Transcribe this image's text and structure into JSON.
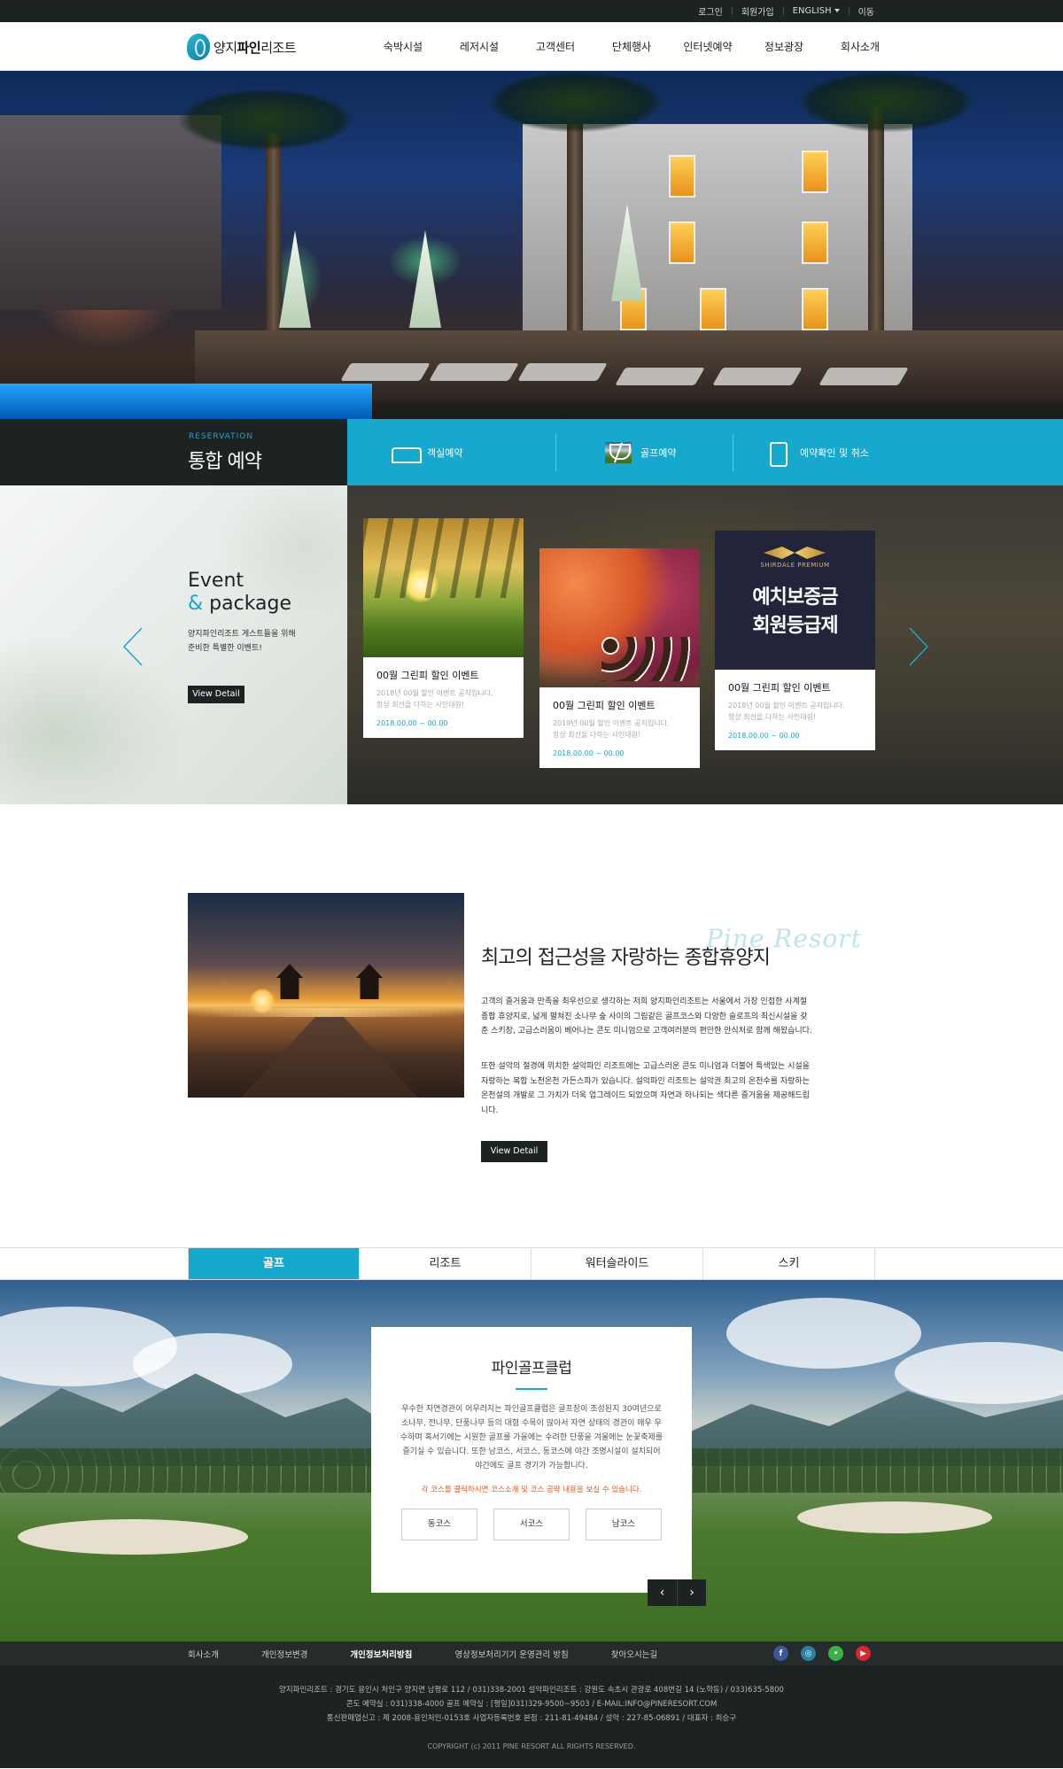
{
  "topbar": {
    "links": [
      "로그인",
      "회원가입",
      "ENGLISH",
      "이동"
    ]
  },
  "header": {
    "logo_pre": "양지",
    "logo_bold": "파인",
    "logo_post": "리조트",
    "nav": [
      "숙박시설",
      "레저시설",
      "고객센터",
      "단체행사",
      "인터넷예약",
      "정보광장",
      "회사소개"
    ]
  },
  "reservation": {
    "eyebrow": "RESERVATION",
    "title": "통합 예약",
    "items": [
      {
        "label": "객실예약",
        "icon": "bed-icon"
      },
      {
        "label": "골프예약",
        "icon": "golf-icon"
      },
      {
        "label": "예약확인 및 취소",
        "icon": "phone-icon"
      }
    ]
  },
  "event": {
    "title_line1": "Event",
    "amp": "&",
    "title_line2": "package",
    "desc_line1": "양지파인리조트 게스트들을 위해",
    "desc_line2": "준비한 특별한 이벤트!",
    "button": "View Detail",
    "cards": [
      {
        "title": "00월 그린피 할인 이벤트",
        "desc1": "2018년 00월 할인 이벤트 공지입니다.",
        "desc2": "항상 최선을 다하는 사인대원!",
        "date": "2018.00.00 ~ 00.00"
      },
      {
        "title": "00월 그린피 할인 이벤트",
        "desc1": "2019년 00월 할인 이벤트 공지입니다.",
        "desc2": "항상 최선을 다하는 사인대원!",
        "date": "2018.00.00 ~ 00.00"
      },
      {
        "title": "00월 그린피 할인 이벤트",
        "desc1": "2018년 00월 할인 이벤트 공지입니다.",
        "desc2": "항상 최선을 다하는 사인대원!",
        "date": "2018.00.00 ~ 00.00"
      }
    ],
    "promo": {
      "brand": "SHIRDALE PREMIUM",
      "line1": "예치보증금",
      "line2": "회원등급제"
    }
  },
  "about": {
    "script": "Pine Resort",
    "heading": "최고의 접근성을 자랑하는 종합휴양지",
    "para1": "고객의 즐거움과 만족을 최우선으로 생각하는 저희 양지파인리조트는 서울에서 가장 인접한 사계절 종합 휴양지로, 넓게 펼쳐진 소나무 숲 사이의 그림같은 골프코스와 다양한 슬로프의 최신시설을 갖춘 스키장, 고급스러움이 베어나는 콘도 미니엄으로 고객여러분의 편안한 안식처로 함께 해왔습니다.",
    "para2": "또한 설악의 절경에 위치한 설악파인 리조트에는 고급스러운 콘도 미니엄과 더불어 특색있는 시설을 자랑하는 복합 노천온천 가든스파가 있습니다. 설악파인 리조트는 설악권 최고의 온천수를 자랑하는 온천설의 개발로 그 가치가 더욱 업그레이드 되었으며 자연과 하나되는 색다른 즐거움을 제공해드립니다.",
    "button": "View Detail"
  },
  "tabs": [
    "골프",
    "리조트",
    "워터슬라이드",
    "스키"
  ],
  "golf": {
    "title": "파인골프클럽",
    "desc": "우수한 자연경관이 어우러지는 파인골프클럽은 골프장이 조성된지 30여년으로 소나무, 전나무, 단풍나무 등의 대형 수목이 많아서 자연 상태의 경관이 매우 우수하며 혹서기에는 시원한 골프를 가을에는 수려한 단풍을 겨울에는 눈꽃축제를 즐기실 수 있습니다. 또한 남코스, 서코스, 동코스에 야간 조명시설이 설치되어 야간에도 골프 경기가 가능합니다.",
    "note": "각 코스를 클릭하시면 코스소개 및 코스 공략 내용을 보실 수 있습니다.",
    "courses": [
      "동코스",
      "서코스",
      "남코스"
    ]
  },
  "footer": {
    "links": [
      "회사소개",
      "개인정보변경",
      "개인정보처리방침",
      "영상정보처리기기 운영관리 방침",
      "찾아오시는길"
    ],
    "line1": "양지파인리조트 : 경기도 용인시 처인구 양지면 남평로 112 / 031)338-2001     설악파인리조트 : 강원도 속초시 관광로 408번길 14 (노학동) / 033)635-5800",
    "line2": "콘도 예약실 : 031)338-4000    골프 예약실 : [평일]031)329-9500~9503 / E-MAIL:INFO@PINERESORT.COM",
    "line3": "통신판매업신고 : 제 2008-용인처인-0153호    사업자등록번호 본점 : 211-81-49484 / 설악 : 227-85-06891 / 대표자 : 최승구",
    "copyright": "COPYRIGHT (c) 2011 PINE RESORT ALL RIGHTS RESERVED.",
    "sns": [
      {
        "name": "facebook-icon",
        "glyph": "f",
        "color": "#3b5998"
      },
      {
        "name": "instagram-icon",
        "glyph": "◎",
        "color": "#2e7fa3"
      },
      {
        "name": "line-icon",
        "glyph": "•",
        "color": "#37b34a"
      },
      {
        "name": "youtube-icon",
        "glyph": "▶",
        "color": "#d8262d"
      }
    ]
  },
  "colors": {
    "accent": "#16a8cd",
    "dark": "#1d2223"
  }
}
